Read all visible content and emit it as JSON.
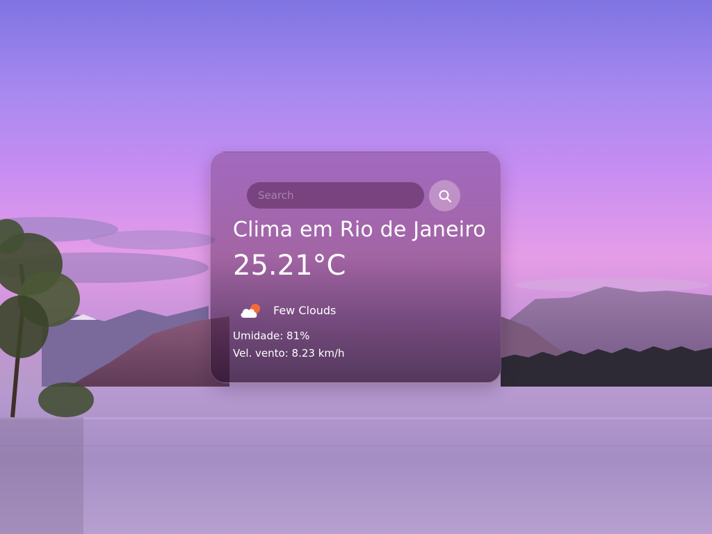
{
  "search": {
    "placeholder": "Search",
    "value": "",
    "button_icon": "search-icon"
  },
  "weather": {
    "title": "Clima em Rio de Janeiro",
    "temperature": "25.21°C",
    "condition": "Few Clouds",
    "condition_icon": "few-clouds-icon",
    "humidity": "Umidade: 81%",
    "wind": "Vel. vento: 8.23 km/h"
  },
  "colors": {
    "sky_top": "#7f74e2",
    "sky_mid": "#e59de7",
    "lake": "#ab95c8",
    "card_tint": "#5a285a"
  }
}
